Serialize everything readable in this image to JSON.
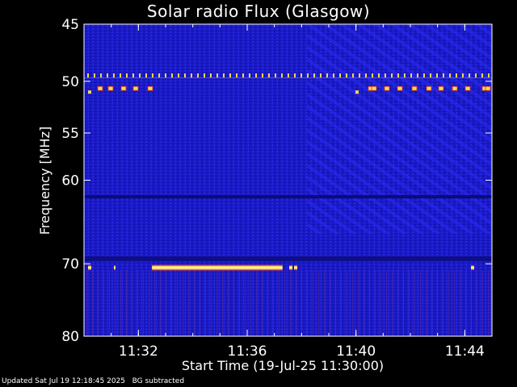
{
  "chart_data": {
    "type": "heatmap",
    "title": "Solar radio Flux (Glasgow)",
    "xlabel": "Start Time (19-Jul-25 11:30:00)",
    "ylabel": "Frequency [MHz]",
    "x_range_minutes": [
      "11:30",
      "11:45"
    ],
    "y_range_mhz": [
      45,
      80
    ],
    "y_scale": "log",
    "y_ticks": [
      {
        "value": 45,
        "label": "45"
      },
      {
        "value": 50,
        "label": "50"
      },
      {
        "value": 55,
        "label": "55"
      },
      {
        "value": 60,
        "label": "60"
      },
      {
        "value": 70,
        "label": "70"
      },
      {
        "value": 80,
        "label": "80"
      }
    ],
    "x_ticks": [
      {
        "value": "11:32",
        "label": "11:32"
      },
      {
        "value": "11:36",
        "label": "11:36"
      },
      {
        "value": "11:40",
        "label": "11:40"
      },
      {
        "value": "11:44",
        "label": "11:44"
      }
    ],
    "background_color": "#1c1ccc",
    "hot_color": "#ffd84a",
    "interference": [
      {
        "name": "dotted-line-49.5",
        "freq_mhz": 49.5,
        "start": "11:30",
        "end": "11:45"
      },
      {
        "name": "bursts-50.7",
        "freq_mhz": 50.7,
        "start": "11:30",
        "end": "11:45"
      },
      {
        "name": "strong-band-70.5",
        "freq_mhz": 70.5,
        "start": "11:32.5",
        "end": "11:37.3"
      }
    ]
  },
  "footer": {
    "updated": "Updated Sat Jul 19 12:18:45 2025",
    "note": "BG subtracted"
  }
}
